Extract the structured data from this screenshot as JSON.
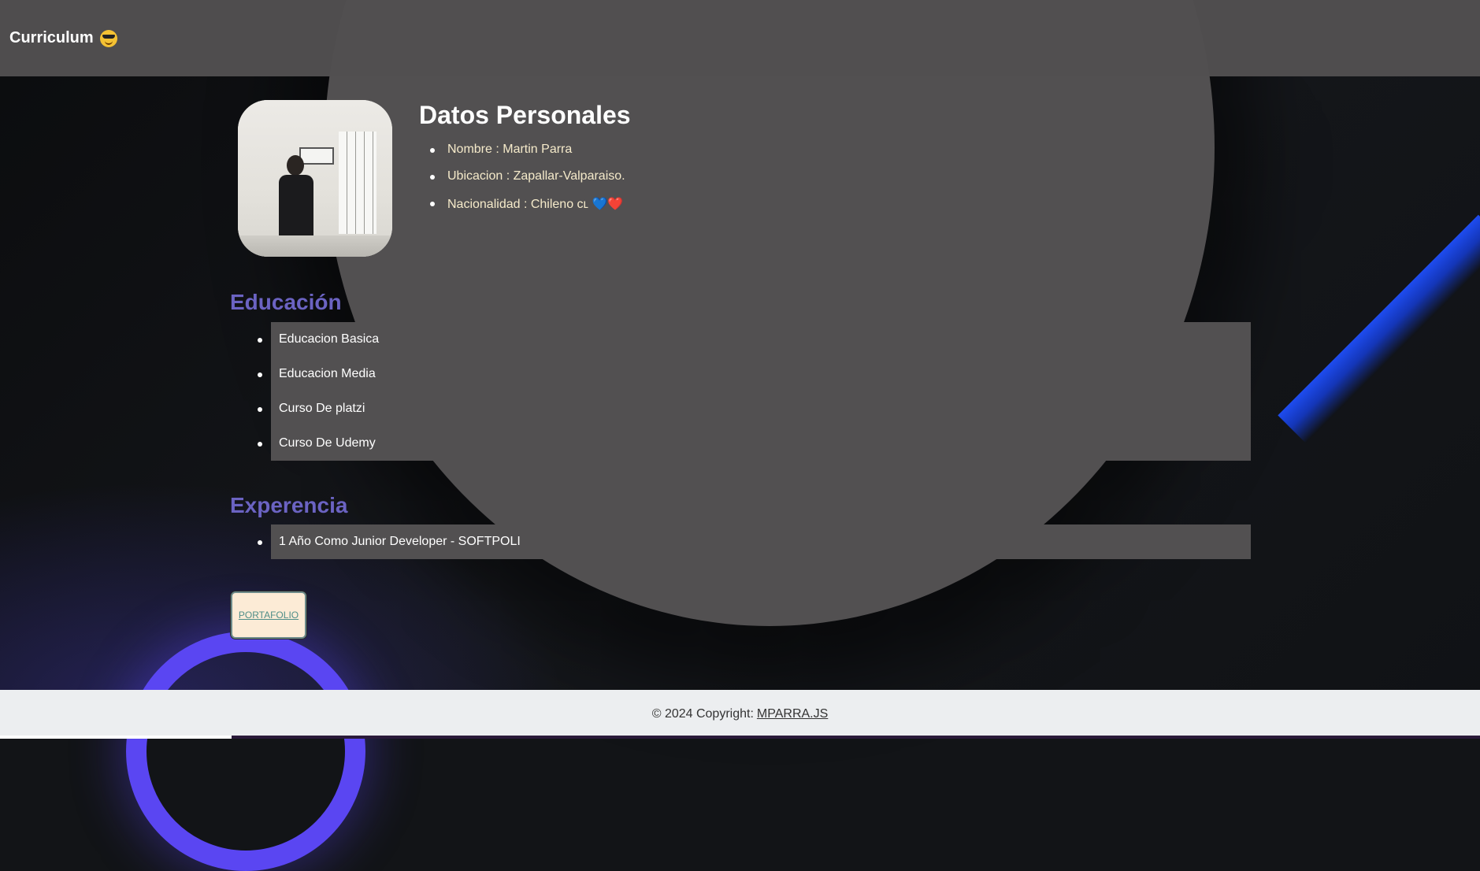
{
  "navbar": {
    "brand": "Curriculum",
    "brand_icon": "smiling-face-with-sunglasses-icon"
  },
  "personal": {
    "title": "Datos Personales",
    "items": [
      "Nombre : Martin Parra",
      "Ubicacion : Zapallar-Valparaiso.",
      "Nacionalidad : Chileno ᴄʟ 💙❤️"
    ]
  },
  "education": {
    "title": "Educación",
    "items": [
      "Educacion Basica",
      "Educacion Media",
      "Curso De platzi",
      "Curso De Udemy"
    ]
  },
  "experience": {
    "title": "Experencia",
    "items": [
      "1 Año Como Junior Developer - SOFTPOLI"
    ]
  },
  "portfolio_button": "PORTAFOLIO",
  "footer": {
    "text": "© 2024 Copyright:",
    "link": "MPARRA.JS"
  },
  "colors": {
    "section_title": "#6b63c2",
    "panel_bg": "#525051",
    "page_bg": "#121417",
    "footer_bg": "#eceef0",
    "accent_blue": "#1e4cf0",
    "ring_purple": "#5a46f2"
  }
}
